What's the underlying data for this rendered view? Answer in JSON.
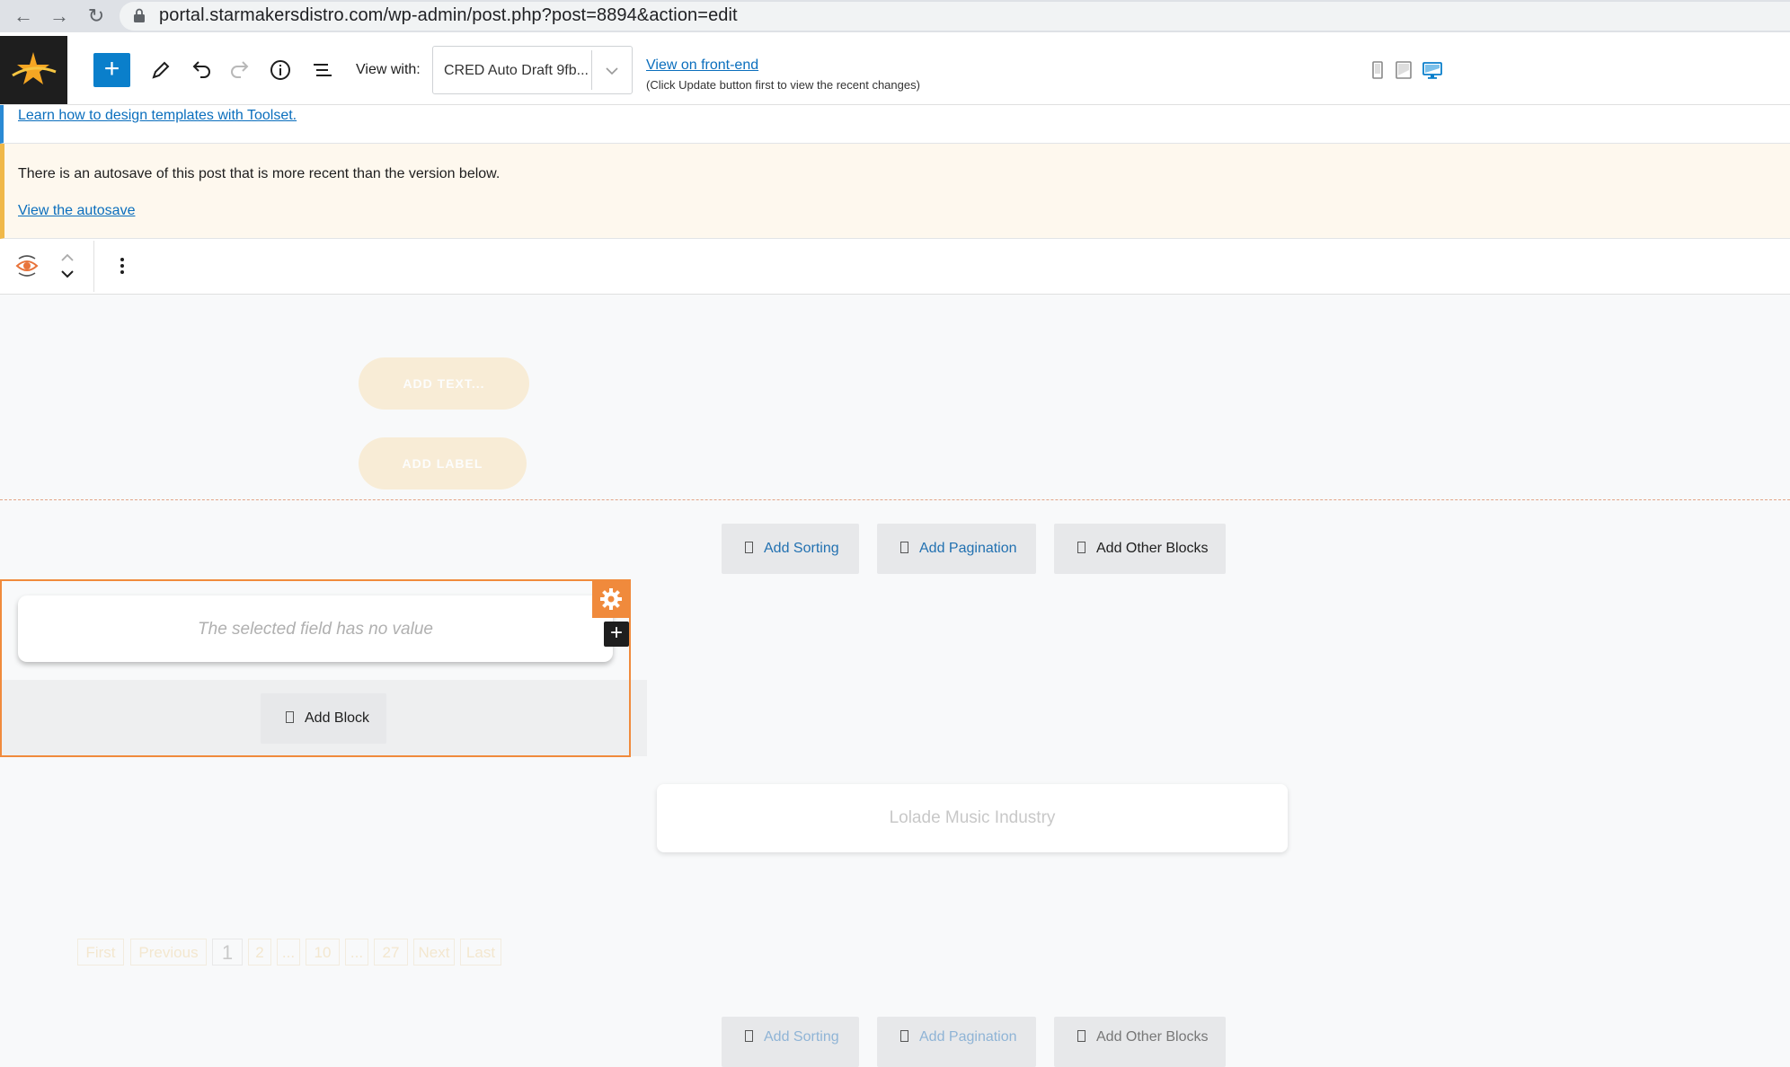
{
  "browser": {
    "url": "portal.starmakersdistro.com/wp-admin/post.php?post=8894&action=edit"
  },
  "toolbar": {
    "view_with_label": "View with:",
    "template_select_value": "CRED Auto Draft 9fb...",
    "front_end_link": "View on front-end",
    "front_end_note": "(Click Update button first to view the recent changes)"
  },
  "notices": {
    "toolset_link": "Learn how to design templates with Toolset.",
    "autosave_message": "There is an autosave of this post that is more recent than the version below.",
    "autosave_link": "View the autosave"
  },
  "canvas": {
    "add_text_button": "ADD TEXT...",
    "add_label_button": "ADD LABEL",
    "top_actions": {
      "add_sorting": "Add Sorting",
      "add_pagination": "Add Pagination",
      "add_other_blocks": "Add Other Blocks"
    },
    "selected_field_placeholder": "The selected field has no value",
    "add_block": "Add Block",
    "title_text": "Lolade Music Industry",
    "pagination": [
      "First",
      "Previous",
      "1",
      "2",
      "...",
      "10",
      "...",
      "27",
      "Next",
      "Last"
    ],
    "bottom_actions": {
      "add_sorting": "Add Sorting",
      "add_pagination": "Add Pagination",
      "add_other_blocks": "Add Other Blocks"
    }
  },
  "colors": {
    "accent_blue": "#0a7fcb",
    "link_blue": "#0a6ebd",
    "selection_orange": "#f08a3c",
    "notice_warning": "#f0b849"
  }
}
